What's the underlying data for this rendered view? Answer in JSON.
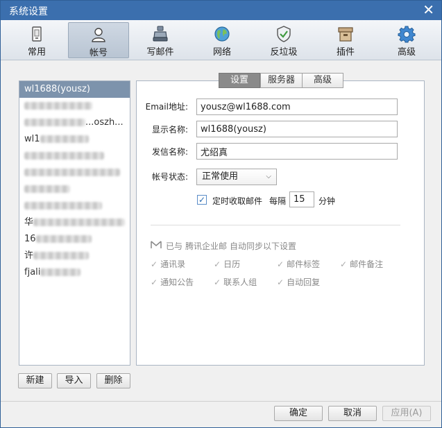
{
  "window": {
    "title": "系统设置"
  },
  "toolbar": {
    "items": [
      {
        "label": "常用",
        "icon": "general-icon"
      },
      {
        "label": "帐号",
        "icon": "account-icon"
      },
      {
        "label": "写邮件",
        "icon": "compose-icon"
      },
      {
        "label": "网络",
        "icon": "network-icon"
      },
      {
        "label": "反垃圾",
        "icon": "antispam-icon"
      },
      {
        "label": "插件",
        "icon": "plugin-icon"
      },
      {
        "label": "高级",
        "icon": "advanced-gear-icon"
      }
    ],
    "active": "帐号"
  },
  "accounts": {
    "selected": "wl1688(yousz)",
    "partial": [
      "...oszh...",
      "wl1",
      "华",
      "16",
      "许",
      "fjali"
    ]
  },
  "account_buttons": {
    "new": "新建",
    "import": "导入",
    "delete": "删除"
  },
  "tabs": {
    "settings": "设置",
    "server": "服务器",
    "advanced": "高级"
  },
  "form": {
    "email_label": "Email地址:",
    "email_value": "yousz@wl1688.com",
    "display_label": "显示名称:",
    "display_value": "wl1688(yousz)",
    "sender_label": "发信名称:",
    "sender_value": "尤绍真",
    "status_label": "帐号状态:",
    "status_value": "正常使用",
    "timer_checkbox_label": "定时收取邮件",
    "every_label": "每隔",
    "interval_value": "15",
    "minutes_label": "分钟"
  },
  "sync": {
    "prefix": "已与",
    "service": "腾讯企业邮",
    "suffix": "自动同步以下设置",
    "items": [
      "通讯录",
      "日历",
      "邮件标签",
      "邮件备注",
      "通知公告",
      "联系人组",
      "自动回复"
    ]
  },
  "footer": {
    "ok": "确定",
    "cancel": "取消",
    "apply": "应用(A)"
  },
  "colors": {
    "titlebar": "#3b6fae",
    "selected_row": "#7d93ac",
    "active_tab": "#8a8a8a"
  }
}
